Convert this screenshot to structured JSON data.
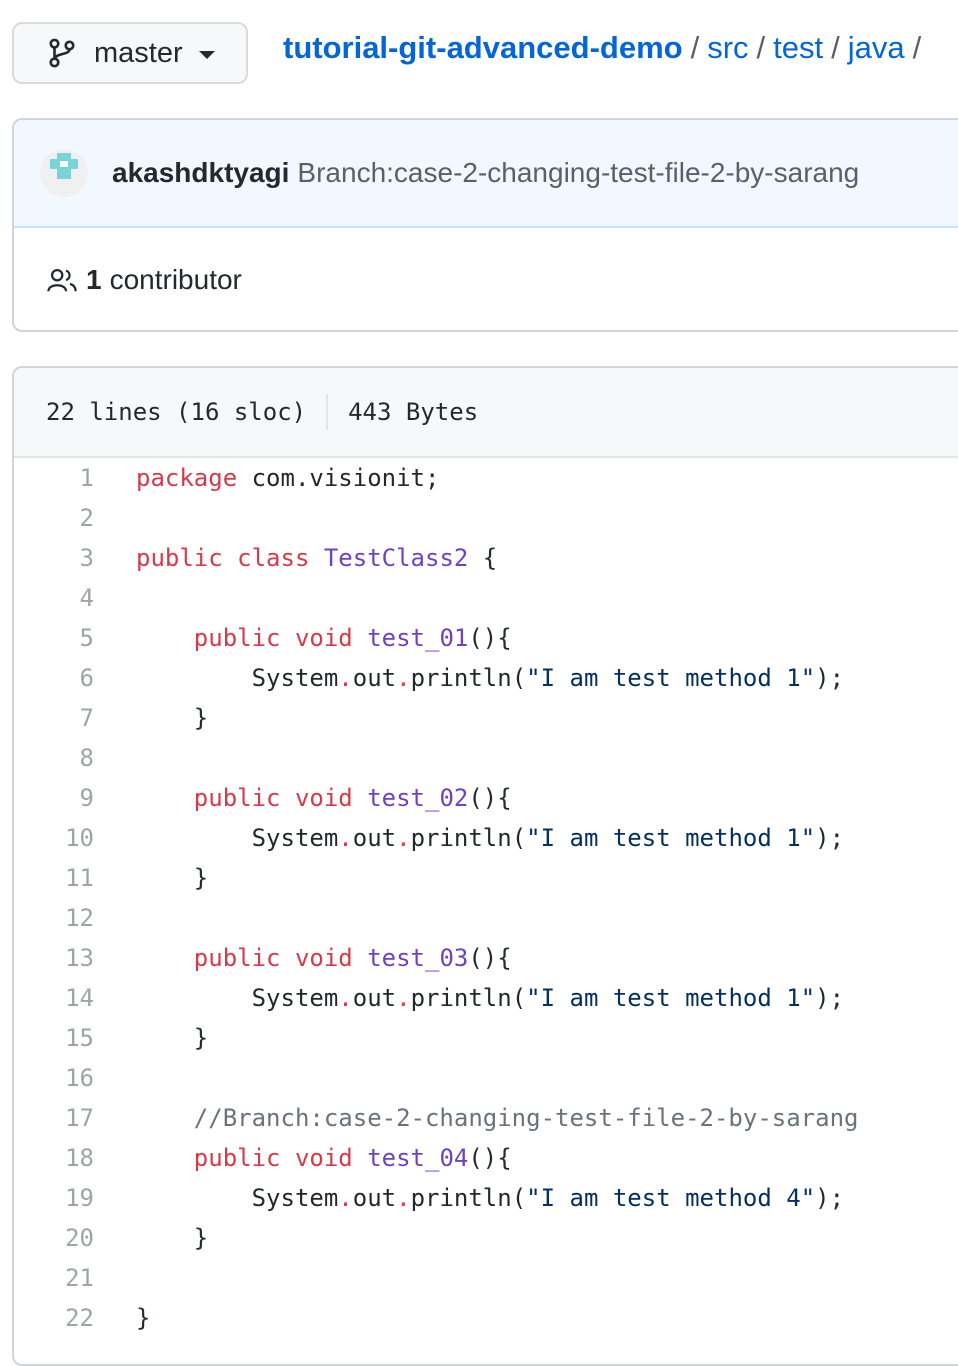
{
  "branch": {
    "label": "master",
    "icon": "git-branch-icon"
  },
  "breadcrumb": {
    "repo": "tutorial-git-advanced-demo",
    "parts": [
      "src",
      "test",
      "java"
    ],
    "separator": "/"
  },
  "commit": {
    "author": "akashdktyagi",
    "message": "Branch:case-2-changing-test-file-2-by-sarang"
  },
  "contributors": {
    "count": "1",
    "label": "contributor",
    "icon": "people-icon"
  },
  "file": {
    "lines_info": "22 lines (16 sloc)",
    "size": "443 Bytes"
  },
  "code_lines": [
    [
      [
        "kw",
        "package"
      ],
      [
        "p",
        " com.visionit;"
      ]
    ],
    [],
    [
      [
        "kw",
        "public"
      ],
      [
        "p",
        " "
      ],
      [
        "kw",
        "class"
      ],
      [
        "p",
        " "
      ],
      [
        "fn",
        "TestClass2"
      ],
      [
        "p",
        " {"
      ]
    ],
    [],
    [
      [
        "p",
        "    "
      ],
      [
        "kw",
        "public"
      ],
      [
        "p",
        " "
      ],
      [
        "kw",
        "void"
      ],
      [
        "p",
        " "
      ],
      [
        "fn",
        "test_01"
      ],
      [
        "p",
        "(){"
      ]
    ],
    [
      [
        "p",
        "        System"
      ],
      [
        "kw",
        "."
      ],
      [
        "p",
        "out"
      ],
      [
        "kw",
        "."
      ],
      [
        "p",
        "println("
      ],
      [
        "str",
        "\"I am test method 1\""
      ],
      [
        "p",
        ");"
      ]
    ],
    [
      [
        "p",
        "    }"
      ]
    ],
    [],
    [
      [
        "p",
        "    "
      ],
      [
        "kw",
        "public"
      ],
      [
        "p",
        " "
      ],
      [
        "kw",
        "void"
      ],
      [
        "p",
        " "
      ],
      [
        "fn",
        "test_02"
      ],
      [
        "p",
        "(){"
      ]
    ],
    [
      [
        "p",
        "        System"
      ],
      [
        "kw",
        "."
      ],
      [
        "p",
        "out"
      ],
      [
        "kw",
        "."
      ],
      [
        "p",
        "println("
      ],
      [
        "str",
        "\"I am test method 1\""
      ],
      [
        "p",
        ");"
      ]
    ],
    [
      [
        "p",
        "    }"
      ]
    ],
    [],
    [
      [
        "p",
        "    "
      ],
      [
        "kw",
        "public"
      ],
      [
        "p",
        " "
      ],
      [
        "kw",
        "void"
      ],
      [
        "p",
        " "
      ],
      [
        "fn",
        "test_03"
      ],
      [
        "p",
        "(){"
      ]
    ],
    [
      [
        "p",
        "        System"
      ],
      [
        "kw",
        "."
      ],
      [
        "p",
        "out"
      ],
      [
        "kw",
        "."
      ],
      [
        "p",
        "println("
      ],
      [
        "str",
        "\"I am test method 1\""
      ],
      [
        "p",
        ");"
      ]
    ],
    [
      [
        "p",
        "    }"
      ]
    ],
    [],
    [
      [
        "p",
        "    "
      ],
      [
        "cm",
        "//Branch:case-2-changing-test-file-2-by-sarang"
      ]
    ],
    [
      [
        "p",
        "    "
      ],
      [
        "kw",
        "public"
      ],
      [
        "p",
        " "
      ],
      [
        "kw",
        "void"
      ],
      [
        "p",
        " "
      ],
      [
        "fn",
        "test_04"
      ],
      [
        "p",
        "(){"
      ]
    ],
    [
      [
        "p",
        "        System"
      ],
      [
        "kw",
        "."
      ],
      [
        "p",
        "out"
      ],
      [
        "kw",
        "."
      ],
      [
        "p",
        "println("
      ],
      [
        "str",
        "\"I am test method 4\""
      ],
      [
        "p",
        ");"
      ]
    ],
    [
      [
        "p",
        "    }"
      ]
    ],
    [],
    [
      [
        "p",
        "}"
      ]
    ]
  ]
}
